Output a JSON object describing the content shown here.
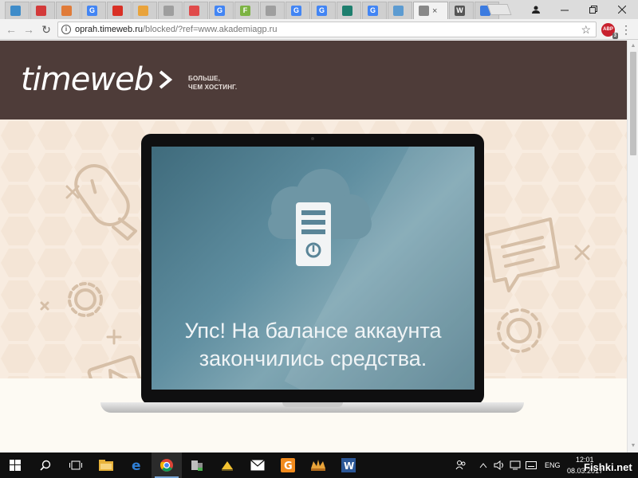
{
  "browser": {
    "tabs": [
      {
        "kind": "favicon",
        "color": "#3f8cc9"
      },
      {
        "kind": "favicon",
        "color": "#d33a3a"
      },
      {
        "kind": "favicon",
        "color": "#e07b39"
      },
      {
        "kind": "favicon",
        "color": "#4285f4",
        "glyph": "G"
      },
      {
        "kind": "favicon",
        "color": "#d93025"
      },
      {
        "kind": "favicon",
        "color": "#e9a33b"
      },
      {
        "kind": "favicon",
        "color": "#9e9e9e"
      },
      {
        "kind": "favicon",
        "color": "#e04b4b"
      },
      {
        "kind": "favicon",
        "color": "#4285f4",
        "glyph": "G"
      },
      {
        "kind": "favicon",
        "color": "#7cb342",
        "glyph": "F"
      },
      {
        "kind": "favicon",
        "color": "#9e9e9e"
      },
      {
        "kind": "favicon",
        "color": "#4285f4",
        "glyph": "G"
      },
      {
        "kind": "favicon",
        "color": "#4285f4",
        "glyph": "G"
      },
      {
        "kind": "favicon",
        "color": "#1e7f6e"
      },
      {
        "kind": "favicon",
        "color": "#4285f4",
        "glyph": "G"
      },
      {
        "kind": "favicon",
        "color": "#5c9bd1"
      },
      {
        "kind": "favicon",
        "color": "#888888",
        "active": true
      },
      {
        "kind": "favicon",
        "color": "#555555",
        "glyph": "W"
      },
      {
        "kind": "favicon",
        "color": "#3b7be0"
      }
    ],
    "url_host": "oprah.timeweb.ru",
    "url_path": "/blocked/?ref=www.akademiagp.ru",
    "adblock_label": "ABP",
    "adblock_count": "3"
  },
  "page": {
    "logo": "timeweb",
    "tagline_line1": "БОЛЬШЕ,",
    "tagline_line2": "ЧЕМ ХОСТИНГ.",
    "message_line1": "Упс! На балансе аккаунта",
    "message_line2": "закончились средства.",
    "colors": {
      "header_bg": "#4e3c39",
      "hero_bg": "#f8ece0",
      "icon_stroke": "#d6bfa7"
    }
  },
  "taskbar": {
    "lang": "ENG",
    "time": "12:01",
    "date": "08.03.2017",
    "watermark": "Fishki.net",
    "apps": [
      "file-explorer",
      "edge",
      "chrome",
      "app-blocks",
      "app-yellow",
      "mail",
      "app-orange",
      "app-crown",
      "word"
    ]
  }
}
